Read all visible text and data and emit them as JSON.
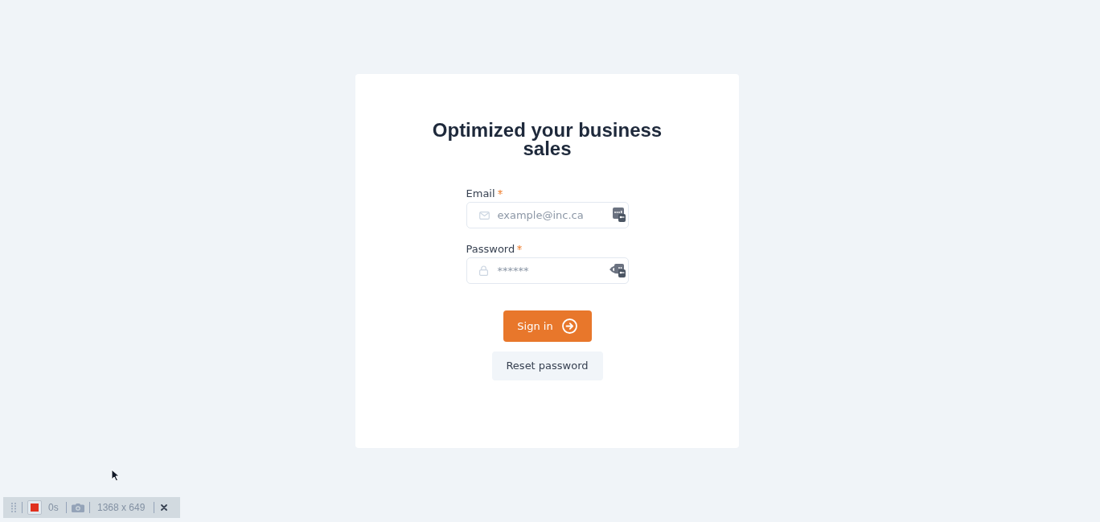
{
  "form": {
    "title": "Optimized your business sales",
    "fields": [
      {
        "kind": "email",
        "label": "Email",
        "required": true,
        "placeholder": "example@inc.ca"
      },
      {
        "kind": "password",
        "label": "Password",
        "required": true,
        "placeholder": "******"
      }
    ],
    "buttons": [
      {
        "kind": "primary",
        "label": "Sign in"
      },
      {
        "kind": "secondary",
        "label": "Reset password"
      }
    ]
  },
  "recorder_bar": {
    "timer": "0s",
    "size": "1368 x 649"
  }
}
